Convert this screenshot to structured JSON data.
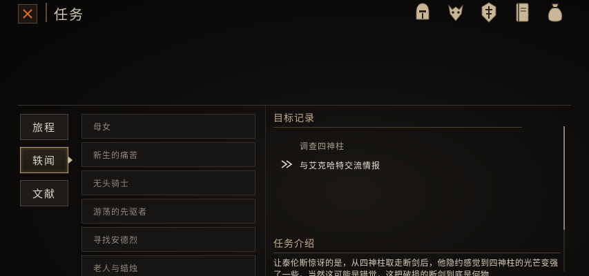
{
  "header": {
    "title": "任务"
  },
  "top_icons": [
    "helmet-icon",
    "beast-skull-icon",
    "shield-emblem-icon",
    "journal-icon",
    "pouch-icon"
  ],
  "nav": {
    "items": [
      {
        "label": "旅程",
        "active": false
      },
      {
        "label": "轶闻",
        "active": true
      },
      {
        "label": "文献",
        "active": false
      }
    ]
  },
  "quests": [
    "母女",
    "新生的痛苦",
    "无头骑士",
    "游荡的先驱者",
    "寻找安德烈",
    "老人与蜡烛"
  ],
  "objectives": {
    "title": "目标记录",
    "items": [
      {
        "text": "调查四神柱",
        "current": false
      },
      {
        "text": "与艾克哈特交流情报",
        "current": true
      }
    ]
  },
  "intro": {
    "title": "任务介绍",
    "text": "让泰伦斯惊讶的是，从四神柱取走断剑后，他隐约感觉到四神柱的光芒变强了一些。当然这可能是错觉，这把破损的断剑到底是何物"
  },
  "colors": {
    "accent_gold": "#b99962",
    "text_main": "#d9d1c1",
    "text_dim": "#8f877b"
  }
}
